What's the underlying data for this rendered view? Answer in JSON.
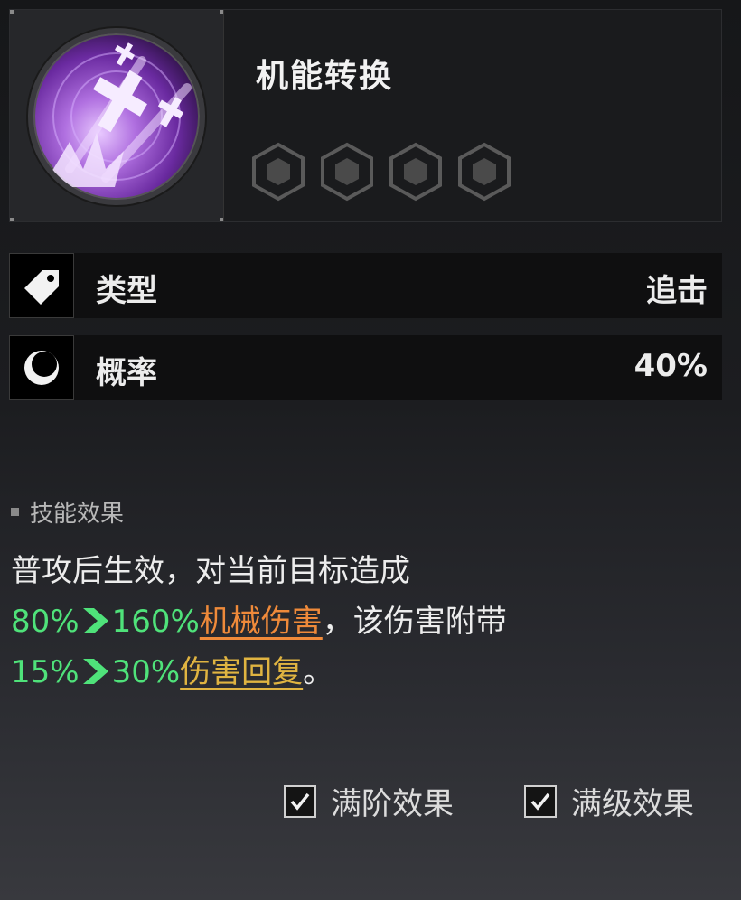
{
  "skill": {
    "title": "机能转换",
    "icon": "purple-cross-burst-icon",
    "star_count": 4,
    "accent_color": "#8e4ad0"
  },
  "rows": [
    {
      "icon": "tag-icon",
      "label": "类型",
      "value": "追击"
    },
    {
      "icon": "moon-icon",
      "label": "概率",
      "value": "40%"
    }
  ],
  "effect": {
    "section_title": "技能效果",
    "line1": "普攻后生效，对当前目标造成",
    "line2_from": "80%",
    "line2_to": "160%",
    "line2_keyword": "机械伤害",
    "line2_rest": "，该伤害附带",
    "line3_from": "15%",
    "line3_to": "30%",
    "line3_keyword": "伤害回复",
    "line3_rest": "。",
    "colors": {
      "value": "#4fe27a",
      "keyword1": "#ef8a3a",
      "keyword2": "#e0b441"
    }
  },
  "checkboxes": [
    {
      "label": "满阶效果",
      "checked": true
    },
    {
      "label": "满级效果",
      "checked": true
    }
  ]
}
